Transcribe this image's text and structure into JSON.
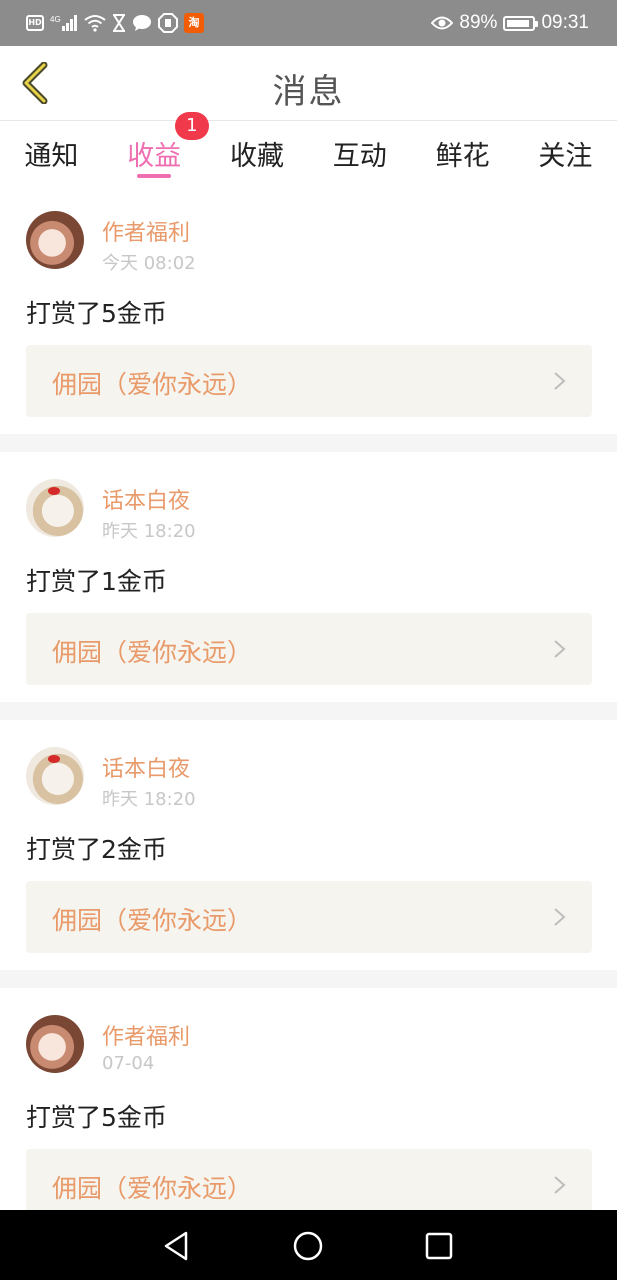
{
  "status_bar": {
    "hd": "HD",
    "network": "4G",
    "taobao": "淘",
    "battery": "89%",
    "time": "09:31"
  },
  "header": {
    "title": "消息"
  },
  "tabs": [
    {
      "label": "通知"
    },
    {
      "label": "收益",
      "badge": "1"
    },
    {
      "label": "收藏"
    },
    {
      "label": "互动"
    },
    {
      "label": "鲜花"
    },
    {
      "label": "关注"
    }
  ],
  "colors": {
    "accent": "#ef6eb1",
    "badge": "#f0394b",
    "sender": "#e99a6a"
  },
  "messages": [
    {
      "sender": "作者福利",
      "time": "今天 08:02",
      "text": "打赏了5金币",
      "link": "佣园（爱你永远）"
    },
    {
      "sender": "话本白夜",
      "time": "昨天 18:20",
      "text": "打赏了1金币",
      "link": "佣园（爱你永远）"
    },
    {
      "sender": "话本白夜",
      "time": "昨天 18:20",
      "text": "打赏了2金币",
      "link": "佣园（爱你永远）"
    },
    {
      "sender": "作者福利",
      "time": "07-04",
      "text": "打赏了5金币",
      "link": "佣园（爱你永远）"
    }
  ]
}
